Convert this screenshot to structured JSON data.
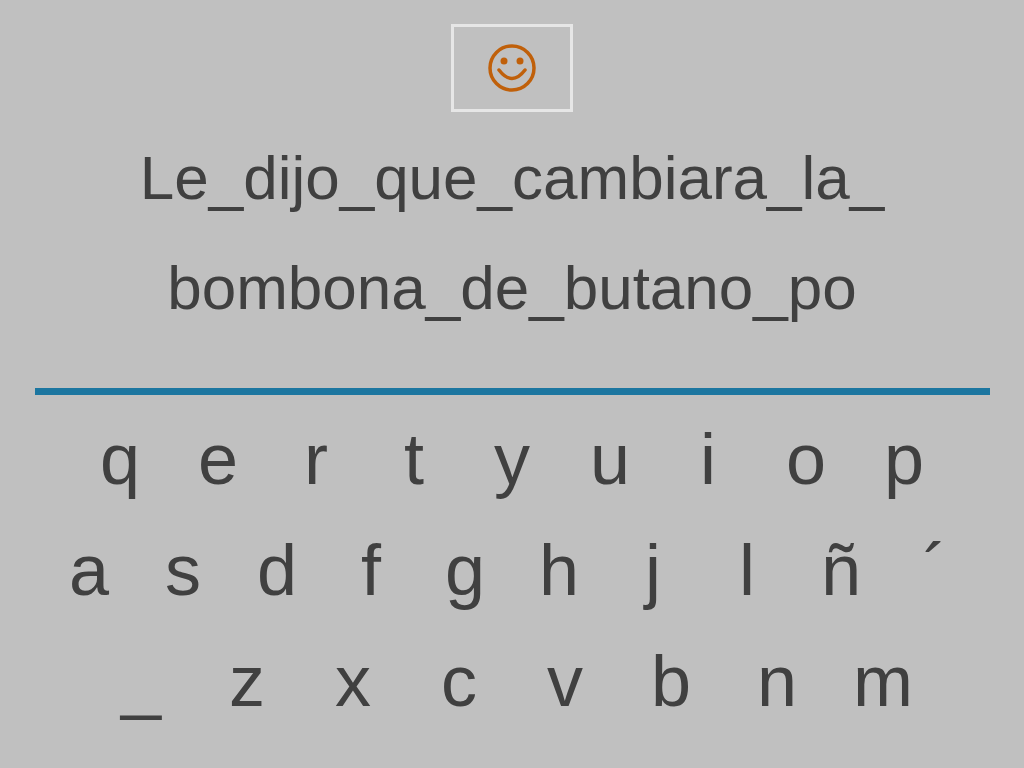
{
  "sentence_lines": [
    "Le_dijo_que_cambiara_la_",
    "bombona_de_butano_po"
  ],
  "keyboard_rows": [
    [
      "q",
      "e",
      "r",
      "t",
      "y",
      "u",
      "i",
      "o",
      "p"
    ],
    [
      "a",
      "s",
      "d",
      "f",
      "g",
      "h",
      "j",
      "l",
      "ñ",
      "´"
    ],
    [
      "_",
      "z",
      "x",
      "c",
      "v",
      "b",
      "n",
      "m"
    ]
  ]
}
